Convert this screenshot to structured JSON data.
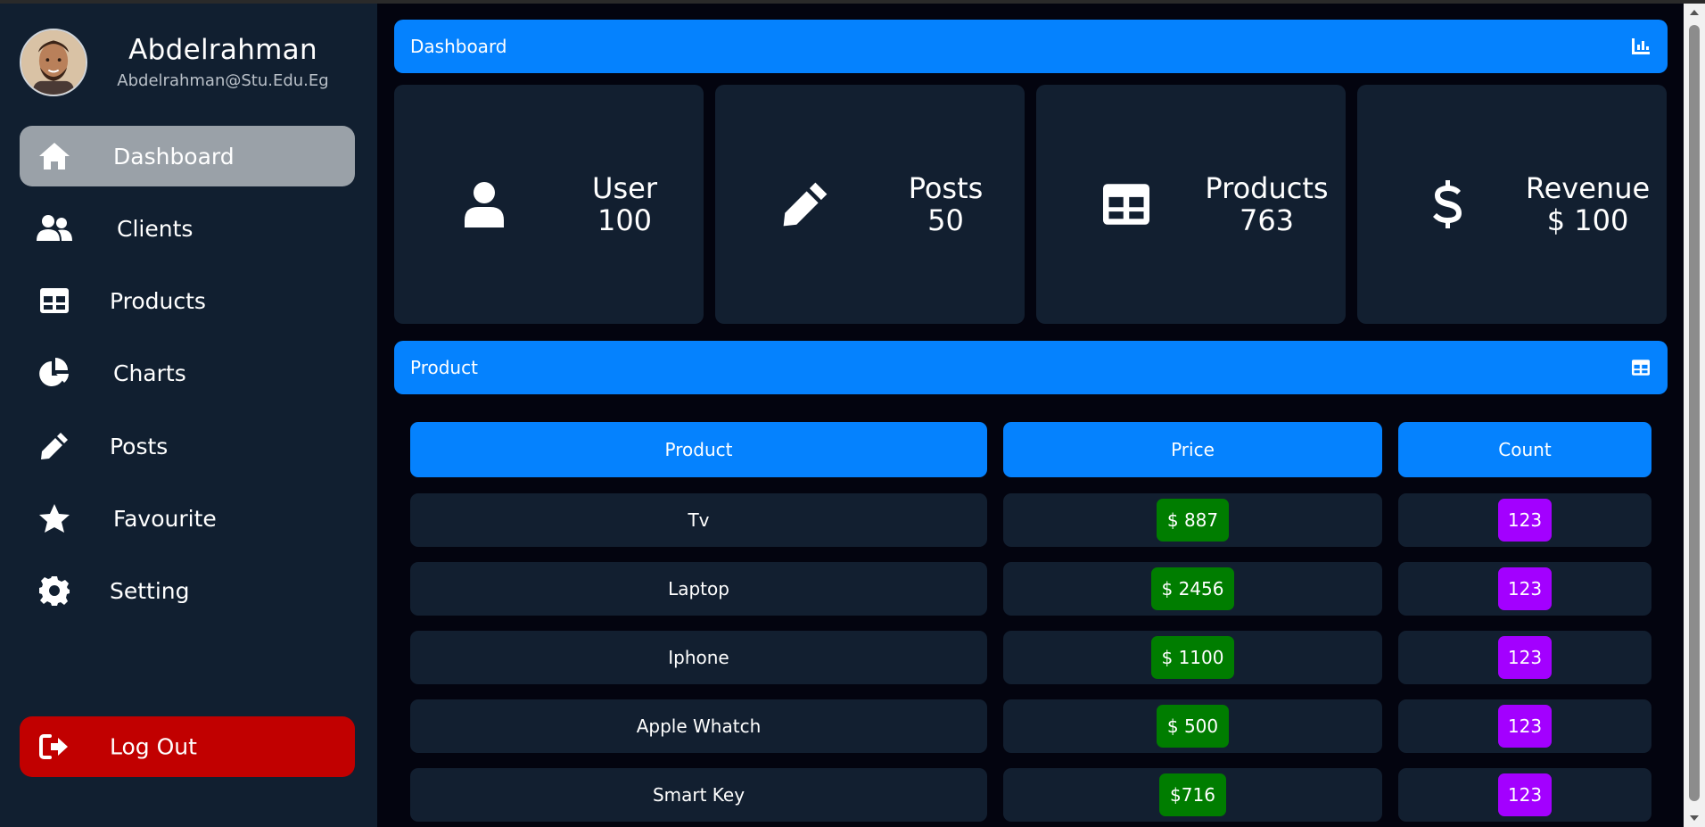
{
  "profile": {
    "name": "Abdelrahman",
    "email": "Abdelrahman@Stu.Edu.Eg"
  },
  "sidebar": {
    "items": [
      {
        "label": "Dashboard",
        "icon": "home-icon",
        "active": true
      },
      {
        "label": "Clients",
        "icon": "users-icon",
        "active": false
      },
      {
        "label": "Products",
        "icon": "table-icon",
        "active": false
      },
      {
        "label": "Charts",
        "icon": "pie-chart-icon",
        "active": false
      },
      {
        "label": "Posts",
        "icon": "pencil-icon",
        "active": false
      },
      {
        "label": "Favourite",
        "icon": "star-icon",
        "active": false
      },
      {
        "label": "Setting",
        "icon": "gear-icon",
        "active": false
      }
    ],
    "logout_label": "Log Out"
  },
  "dashboard_bar": {
    "title": "Dashboard",
    "icon": "bar-chart-icon"
  },
  "stats": [
    {
      "label": "User",
      "value": "100",
      "icon": "user-icon"
    },
    {
      "label": "Posts",
      "value": "50",
      "icon": "pencil-icon"
    },
    {
      "label": "Products",
      "value": "763",
      "icon": "table-icon"
    },
    {
      "label": "Revenue",
      "value": "$ 100",
      "icon": "dollar-icon"
    }
  ],
  "product_bar": {
    "title": "Product",
    "icon": "table-icon"
  },
  "table": {
    "headers": [
      "Product",
      "Price",
      "Count"
    ],
    "rows": [
      {
        "product": "Tv",
        "price": "$ 887",
        "count": "123"
      },
      {
        "product": "Laptop",
        "price": "$ 2456",
        "count": "123"
      },
      {
        "product": "Iphone",
        "price": "$ 1100",
        "count": "123"
      },
      {
        "product": "Apple Whatch",
        "price": "$ 500",
        "count": "123"
      },
      {
        "product": "Smart Key",
        "price": "$716",
        "count": "123"
      }
    ]
  },
  "colors": {
    "sidebar_bg": "#111f30",
    "page_bg": "#03040f",
    "accent_blue": "#0582fe",
    "active_item": "#9aa1a8",
    "logout_red": "#c10000",
    "price_green": "#007d00",
    "count_purple": "#a300ff"
  }
}
